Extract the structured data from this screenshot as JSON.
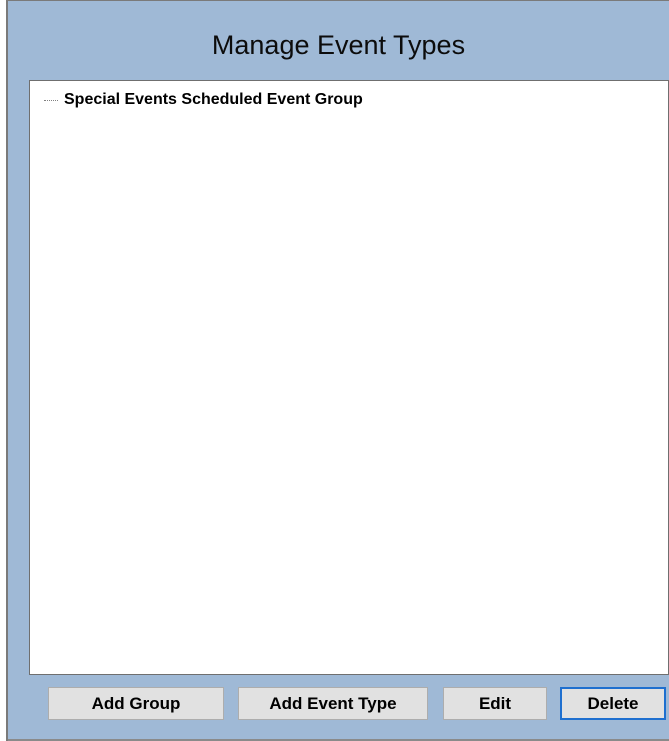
{
  "dialog": {
    "title": "Manage Event Types"
  },
  "tree": {
    "items": [
      {
        "label": "Special Events Scheduled Event Group"
      }
    ]
  },
  "buttons": {
    "add_group": "Add Group",
    "add_event_type": "Add Event Type",
    "edit": "Edit",
    "delete": "Delete"
  },
  "colors": {
    "dialog_background": "#9fb9d6",
    "tree_background": "#ffffff",
    "button_background": "#e1e1e1",
    "focus_border": "#1e6fcf"
  }
}
